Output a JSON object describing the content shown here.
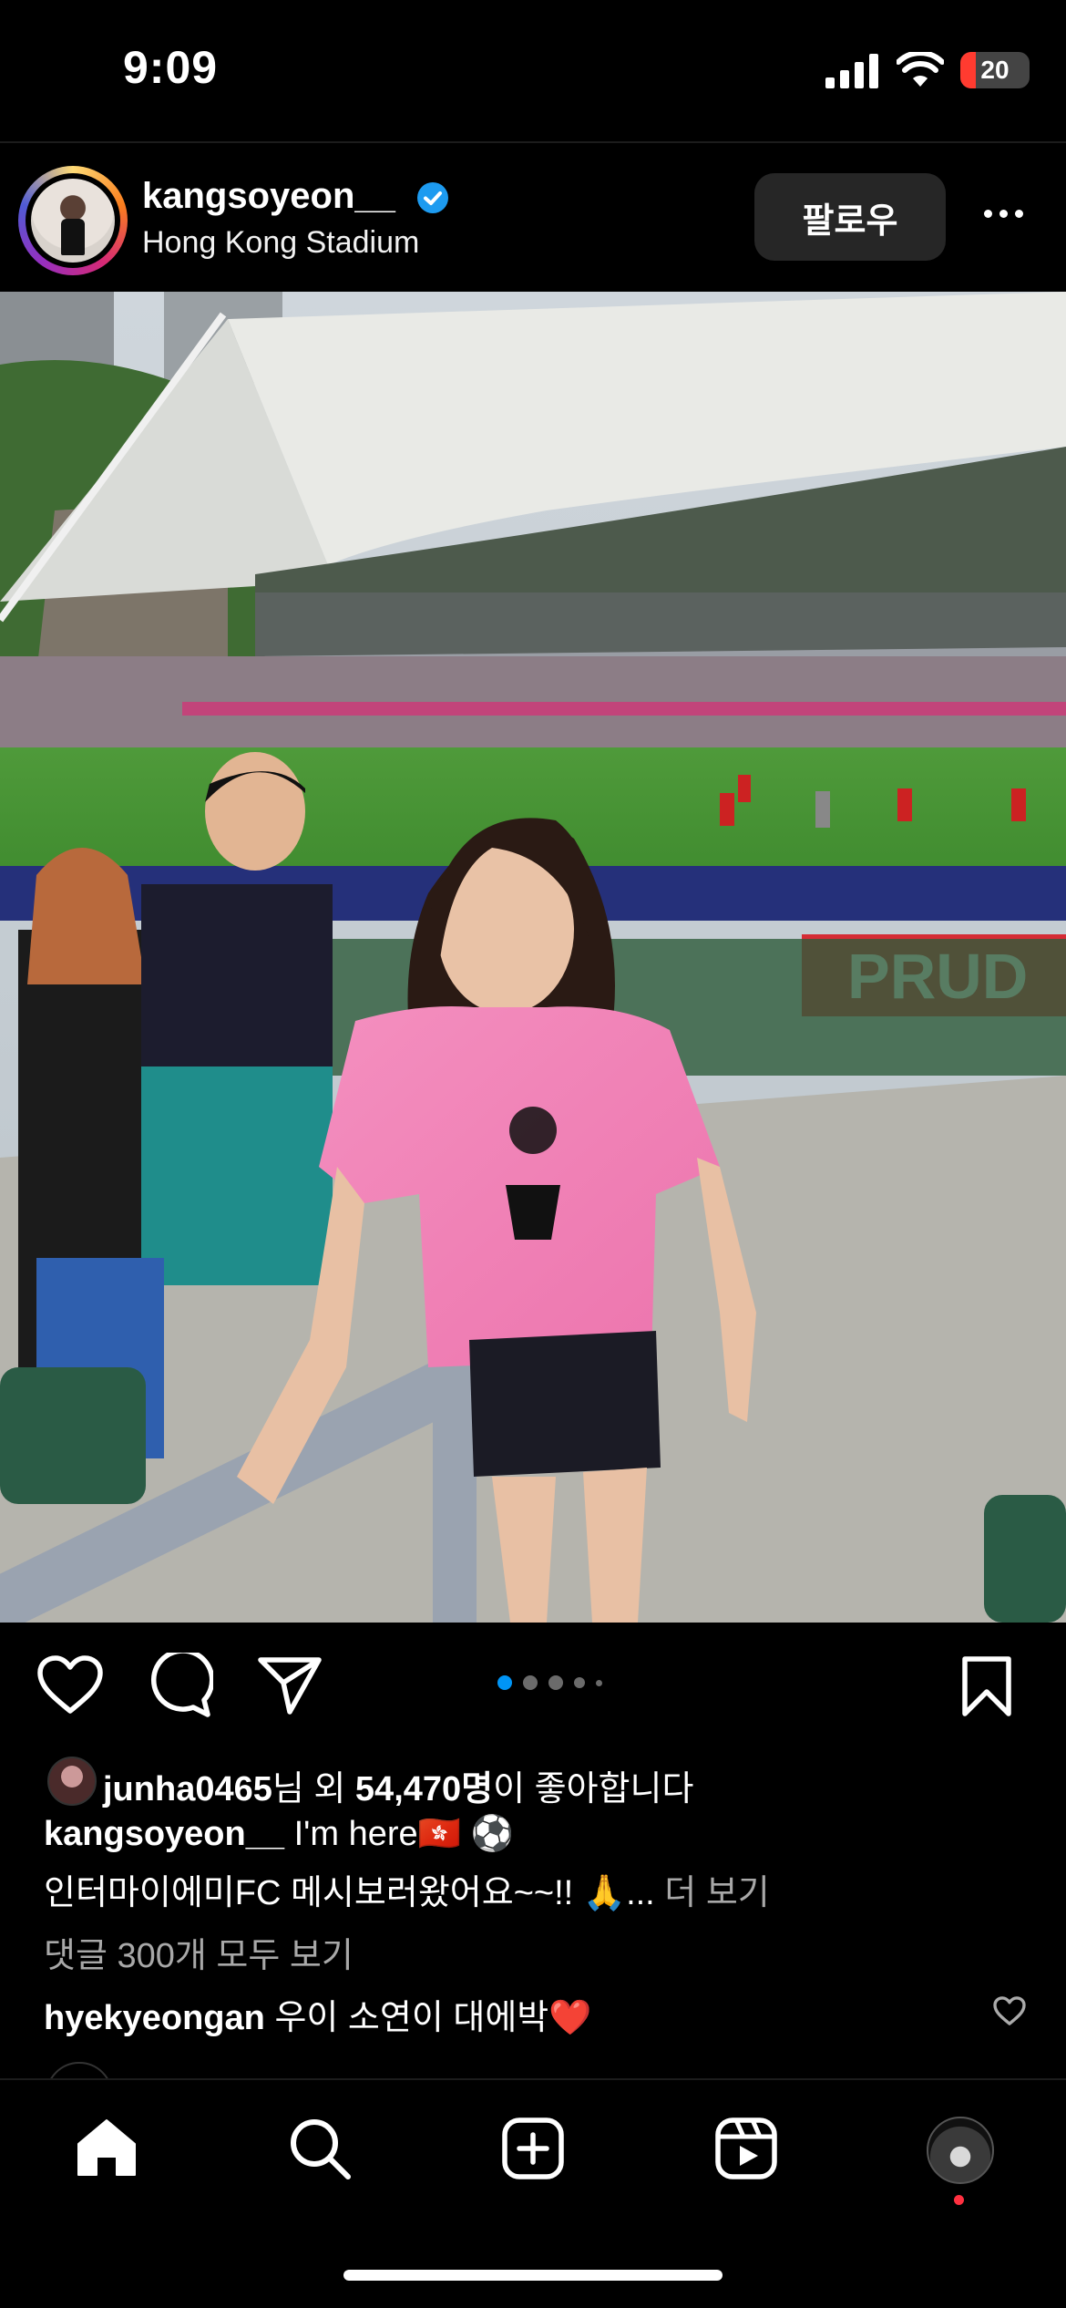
{
  "status_bar": {
    "time": "9:09",
    "battery": "20",
    "icons": [
      "cellular-signal-icon",
      "wifi-icon",
      "battery-low-icon"
    ]
  },
  "post_header": {
    "username": "kangsoyeon__",
    "verified": true,
    "location": "Hong Kong Stadium",
    "follow_label": "팔로우",
    "more_icon": "more-horizontal-icon"
  },
  "actions": {
    "icons": [
      "heart-icon",
      "comment-icon",
      "share-icon",
      "bookmark-icon"
    ],
    "carousel": {
      "count": 5,
      "active": 0
    }
  },
  "likes": {
    "user": "junha0465",
    "suffix_1": "님 외 ",
    "count": "54,470명",
    "suffix_2": "이 좋아합니다"
  },
  "caption": {
    "username": "kangsoyeon__",
    "line1": "I'm here🇭🇰 ⚽",
    "line2": "인터마이에미FC 메시보러왔어요~~!! 🙏... ",
    "more": "더 보기"
  },
  "comments": {
    "view_all": "댓글 300개 모두 보기",
    "top_comment": {
      "username": "hyekyeongan",
      "text": "우이 소연이 대에박❤️"
    }
  },
  "bottom_nav": {
    "items": [
      "home-icon",
      "search-icon",
      "create-post-icon",
      "reels-icon",
      "profile-avatar"
    ]
  },
  "colors": {
    "background": "#000000",
    "verified": "#1d9bf0",
    "active_dot": "#0095f6",
    "notification": "#ff3040",
    "follow_button": "#262626"
  }
}
